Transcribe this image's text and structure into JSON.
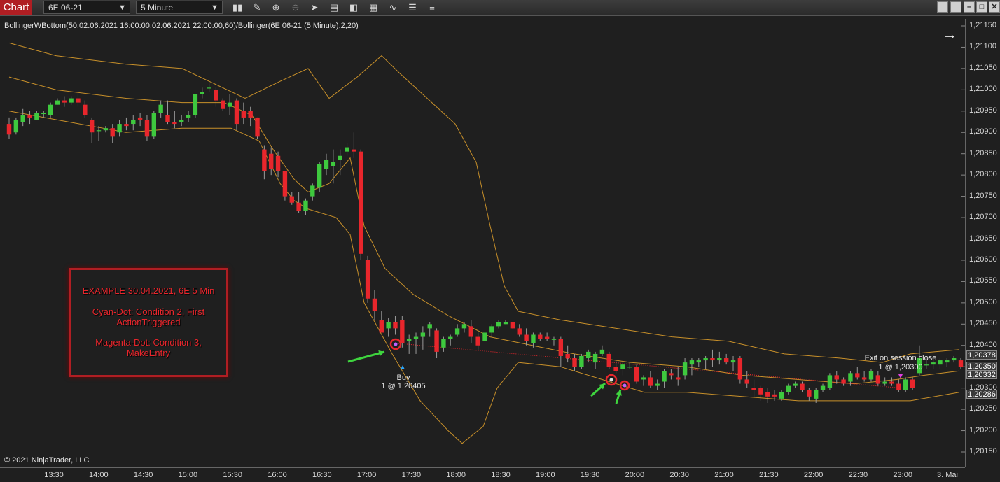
{
  "toolbar": {
    "tab_label": "Chart",
    "instrument": "6E 06-21",
    "interval": "5 Minute",
    "icons": [
      "bar-type-icon",
      "pencil-icon",
      "zoom-in-icon",
      "zoom-out-icon",
      "pointer-icon",
      "data-box-icon",
      "chart-trader-icon",
      "indicators-icon",
      "strategies-icon",
      "properties-icon",
      "list-icon"
    ],
    "window_icons": [
      "tile-icon",
      "maximize-all-icon",
      "minimize-icon",
      "restore-icon",
      "close-icon"
    ]
  },
  "chart": {
    "title": "BollingerWBottom(50,02.06.2021 16:00:00,02.06.2021 22:00:00,60)/Bollinger(6E 06-21 (5 Minute),2,20)",
    "copyright": "© 2021 NinjaTrader, LLC",
    "price_ticks": [
      "1,21150",
      "1,21100",
      "1,21050",
      "1,21000",
      "1,20950",
      "1,20900",
      "1,20850",
      "1,20800",
      "1,20750",
      "1,20700",
      "1,20650",
      "1,20600",
      "1,20550",
      "1,20500",
      "1,20450",
      "1,20400",
      "1,20350",
      "1,20300",
      "1,20250",
      "1,20200",
      "1,20150"
    ],
    "price_badges": [
      "1,20378",
      "1,20350",
      "1,20332",
      "1,20286"
    ],
    "time_ticks": [
      "13:30",
      "14:00",
      "14:30",
      "15:00",
      "15:30",
      "16:00",
      "16:30",
      "17:00",
      "17:30",
      "18:00",
      "18:30",
      "19:00",
      "19:30",
      "20:00",
      "20:30",
      "21:00",
      "21:30",
      "22:00",
      "22:30",
      "23:00",
      "3. Mai"
    ],
    "buy_label": "Buy",
    "buy_fill": "1 @ 1,20405",
    "exit_label": "Exit on session close",
    "exit_fill": "1 @ 1,20300",
    "colors": {
      "up": "#3ec93e",
      "down": "#e8262c",
      "band": "#c8902a",
      "marker": "#e8262c",
      "arrow": "#3ed43e"
    }
  },
  "note": {
    "line1": "EXAMPLE 30.04.2021, 6E 5 Min",
    "line2": "Cyan-Dot: Condition 2, First",
    "line3": "ActionTriggered",
    "line4": "Magenta-Dot: Condition 3,",
    "line5": "MakeEntry"
  },
  "chart_data": {
    "type": "candlestick",
    "y_range": [
      1.2012,
      1.2118
    ],
    "candles": [
      [
        1.2092,
        1.20935,
        1.20885,
        1.20895
      ],
      [
        1.209,
        1.20935,
        1.20895,
        1.2093
      ],
      [
        1.20925,
        1.20955,
        1.20915,
        1.2094
      ],
      [
        1.2094,
        1.2095,
        1.2092,
        1.20935
      ],
      [
        1.2093,
        1.2095,
        1.2093,
        1.20945
      ],
      [
        1.20945,
        1.2095,
        1.20935,
        1.20945
      ],
      [
        1.2094,
        1.2097,
        1.20935,
        1.20965
      ],
      [
        1.20965,
        1.2098,
        1.20965,
        1.20975
      ],
      [
        1.20975,
        1.20985,
        1.2096,
        1.2097
      ],
      [
        1.2097,
        1.20985,
        1.20965,
        1.2098
      ],
      [
        1.2098,
        1.20995,
        1.2096,
        1.2097
      ],
      [
        1.20965,
        1.20975,
        1.20935,
        1.2094
      ],
      [
        1.2093,
        1.20935,
        1.20875,
        1.209
      ],
      [
        1.20905,
        1.20915,
        1.2088,
        1.20905
      ],
      [
        1.20905,
        1.20915,
        1.209,
        1.2091
      ],
      [
        1.2091,
        1.2092,
        1.20875,
        1.2089
      ],
      [
        1.209,
        1.2093,
        1.2089,
        1.2092
      ],
      [
        1.2092,
        1.20935,
        1.20905,
        1.20915
      ],
      [
        1.2092,
        1.2094,
        1.20905,
        1.2093
      ],
      [
        1.20935,
        1.20945,
        1.20915,
        1.2093
      ],
      [
        1.2093,
        1.2094,
        1.2088,
        1.2089
      ],
      [
        1.2089,
        1.2095,
        1.20885,
        1.20945
      ],
      [
        1.20945,
        1.20975,
        1.20935,
        1.20965
      ],
      [
        1.2094,
        1.20975,
        1.2092,
        1.20925
      ],
      [
        1.20925,
        1.2095,
        1.2091,
        1.2092
      ],
      [
        1.20925,
        1.2094,
        1.20915,
        1.2093
      ],
      [
        1.20935,
        1.2095,
        1.20925,
        1.2094
      ],
      [
        1.2094,
        1.2099,
        1.20935,
        1.2099
      ],
      [
        1.2099,
        1.21005,
        1.2098,
        1.20995
      ],
      [
        1.21005,
        1.21015,
        1.20995,
        1.21005
      ],
      [
        1.21,
        1.21005,
        1.2096,
        1.20975
      ],
      [
        1.20975,
        1.2098,
        1.2095,
        1.20955
      ],
      [
        1.2096,
        1.2099,
        1.2094,
        1.2097
      ],
      [
        1.20975,
        1.2098,
        1.20905,
        1.2092
      ],
      [
        1.2095,
        1.2097,
        1.2092,
        1.20935
      ],
      [
        1.2095,
        1.2096,
        1.20915,
        1.20935
      ],
      [
        1.20935,
        1.20935,
        1.20885,
        1.2089
      ],
      [
        1.2086,
        1.2087,
        1.2079,
        1.2081
      ],
      [
        1.2085,
        1.20865,
        1.208,
        1.20815
      ],
      [
        1.20845,
        1.20855,
        1.20795,
        1.2081
      ],
      [
        1.2081,
        1.2081,
        1.2074,
        1.2075
      ],
      [
        1.2075,
        1.2076,
        1.2073,
        1.20735
      ],
      [
        1.20735,
        1.2076,
        1.2071,
        1.20715
      ],
      [
        1.20715,
        1.20745,
        1.20705,
        1.2074
      ],
      [
        1.2075,
        1.2078,
        1.2074,
        1.20775
      ],
      [
        1.2077,
        1.2083,
        1.2076,
        1.20825
      ],
      [
        1.20815,
        1.2085,
        1.208,
        1.20835
      ],
      [
        1.2082,
        1.2086,
        1.2078,
        1.2083
      ],
      [
        1.20835,
        1.2086,
        1.208,
        1.20845
      ],
      [
        1.20855,
        1.20875,
        1.20845,
        1.20865
      ],
      [
        1.2086,
        1.209,
        1.2084,
        1.20855
      ],
      [
        1.20855,
        1.2086,
        1.206,
        1.20615
      ],
      [
        1.206,
        1.2061,
        1.205,
        1.2051
      ],
      [
        1.2051,
        1.2053,
        1.2046,
        1.2048
      ],
      [
        1.2046,
        1.2048,
        1.2043,
        1.2043
      ],
      [
        1.2044,
        1.20465,
        1.2042,
        1.20455
      ],
      [
        1.20455,
        1.2047,
        1.20425,
        1.2044
      ],
      [
        1.2046,
        1.2047,
        1.20395,
        1.20405
      ],
      [
        1.2041,
        1.20425,
        1.2038,
        1.20415
      ],
      [
        1.20415,
        1.2043,
        1.2038,
        1.2042
      ],
      [
        1.2042,
        1.20445,
        1.2039,
        1.2043
      ],
      [
        1.2044,
        1.20455,
        1.2042,
        1.2045
      ],
      [
        1.20435,
        1.2044,
        1.2037,
        1.20385
      ],
      [
        1.20395,
        1.2042,
        1.20385,
        1.20415
      ],
      [
        1.20415,
        1.20425,
        1.204,
        1.2042
      ],
      [
        1.20425,
        1.2045,
        1.2042,
        1.2044
      ],
      [
        1.2044,
        1.20455,
        1.2043,
        1.2045
      ],
      [
        1.20445,
        1.2046,
        1.20405,
        1.2042
      ],
      [
        1.2042,
        1.2043,
        1.2039,
        1.204
      ],
      [
        1.2041,
        1.2044,
        1.20395,
        1.2043
      ],
      [
        1.2043,
        1.2045,
        1.2042,
        1.20445
      ],
      [
        1.20445,
        1.2046,
        1.2044,
        1.20455
      ],
      [
        1.2045,
        1.2046,
        1.2045,
        1.20455
      ],
      [
        1.20455,
        1.20455,
        1.2044,
        1.2044
      ],
      [
        1.2044,
        1.2045,
        1.2042,
        1.20425
      ],
      [
        1.20425,
        1.2044,
        1.204,
        1.2041
      ],
      [
        1.20405,
        1.2043,
        1.20395,
        1.20425
      ],
      [
        1.20425,
        1.2043,
        1.2041,
        1.20415
      ],
      [
        1.2042,
        1.2043,
        1.2041,
        1.20415
      ],
      [
        1.20415,
        1.2042,
        1.204,
        1.20415
      ],
      [
        1.20415,
        1.2042,
        1.2035,
        1.20375
      ],
      [
        1.2038,
        1.204,
        1.2036,
        1.2037
      ],
      [
        1.2037,
        1.2038,
        1.2034,
        1.2035
      ],
      [
        1.2035,
        1.2038,
        1.20345,
        1.20375
      ],
      [
        1.2037,
        1.2039,
        1.2036,
        1.20385
      ],
      [
        1.2036,
        1.20385,
        1.20345,
        1.2038
      ],
      [
        1.2038,
        1.204,
        1.20375,
        1.2039
      ],
      [
        1.2038,
        1.20385,
        1.20345,
        1.2035
      ],
      [
        1.2035,
        1.20365,
        1.20335,
        1.2034
      ],
      [
        1.20345,
        1.20365,
        1.2033,
        1.20355
      ],
      [
        1.2035,
        1.2036,
        1.20345,
        1.2035
      ],
      [
        1.2035,
        1.20355,
        1.2031,
        1.20315
      ],
      [
        1.2032,
        1.2033,
        1.20305,
        1.20325
      ],
      [
        1.20325,
        1.2034,
        1.203,
        1.20305
      ],
      [
        1.20305,
        1.2032,
        1.20295,
        1.2031
      ],
      [
        1.20315,
        1.20345,
        1.203,
        1.2034
      ],
      [
        1.20335,
        1.20345,
        1.2032,
        1.2033
      ],
      [
        1.20325,
        1.2035,
        1.20305,
        1.2032
      ],
      [
        1.2033,
        1.2037,
        1.2032,
        1.2036
      ],
      [
        1.20355,
        1.2037,
        1.2033,
        1.20365
      ],
      [
        1.2036,
        1.2037,
        1.2035,
        1.20365
      ],
      [
        1.20365,
        1.20375,
        1.20345,
        1.2037
      ],
      [
        1.2037,
        1.2039,
        1.2035,
        1.20365
      ],
      [
        1.20365,
        1.20385,
        1.20355,
        1.2037
      ],
      [
        1.2037,
        1.2038,
        1.20355,
        1.2036
      ],
      [
        1.2036,
        1.20375,
        1.2034,
        1.20365
      ],
      [
        1.2037,
        1.20375,
        1.2031,
        1.2032
      ],
      [
        1.2032,
        1.2034,
        1.203,
        1.2031
      ],
      [
        1.203,
        1.2032,
        1.2028,
        1.20295
      ],
      [
        1.203,
        1.20305,
        1.2027,
        1.20285
      ],
      [
        1.2029,
        1.203,
        1.20265,
        1.2028
      ],
      [
        1.20285,
        1.20295,
        1.2027,
        1.2028
      ],
      [
        1.20275,
        1.20295,
        1.2027,
        1.2029
      ],
      [
        1.2029,
        1.2031,
        1.20285,
        1.20305
      ],
      [
        1.20305,
        1.20315,
        1.203,
        1.2031
      ],
      [
        1.2031,
        1.20315,
        1.2029,
        1.20295
      ],
      [
        1.20295,
        1.203,
        1.2027,
        1.2028
      ],
      [
        1.20275,
        1.203,
        1.20265,
        1.20295
      ],
      [
        1.20295,
        1.2031,
        1.2029,
        1.20305
      ],
      [
        1.203,
        1.20335,
        1.20295,
        1.2033
      ],
      [
        1.2033,
        1.2034,
        1.2031,
        1.2032
      ],
      [
        1.2032,
        1.20325,
        1.20305,
        1.2031
      ],
      [
        1.20315,
        1.2034,
        1.20305,
        1.20335
      ],
      [
        1.20335,
        1.2035,
        1.2032,
        1.20325
      ],
      [
        1.20325,
        1.2034,
        1.20315,
        1.2032
      ],
      [
        1.2032,
        1.20345,
        1.20315,
        1.2034
      ],
      [
        1.2033,
        1.2034,
        1.20305,
        1.2031
      ],
      [
        1.2031,
        1.20325,
        1.20305,
        1.20315
      ],
      [
        1.20315,
        1.20325,
        1.20305,
        1.2031
      ],
      [
        1.2031,
        1.2032,
        1.2029,
        1.20295
      ],
      [
        1.20295,
        1.20325,
        1.2029,
        1.2032
      ],
      [
        1.2032,
        1.20325,
        1.20295,
        1.203
      ],
      [
        1.20335,
        1.204,
        1.2033,
        1.2037
      ],
      [
        1.20355,
        1.20375,
        1.20345,
        1.20355
      ],
      [
        1.20355,
        1.20365,
        1.20345,
        1.2036
      ],
      [
        1.20355,
        1.2037,
        1.20345,
        1.20365
      ],
      [
        1.2036,
        1.2037,
        1.2035,
        1.20365
      ],
      [
        1.20365,
        1.20375,
        1.2036,
        1.2037
      ],
      [
        1.20365,
        1.2037,
        1.20345,
        1.2035
      ]
    ],
    "bands": {
      "upper": [
        [
          13,
          1.2111
        ],
        [
          80,
          1.2108
        ],
        [
          180,
          1.2106
        ],
        [
          260,
          1.2105
        ],
        [
          350,
          1.2098
        ],
        [
          400,
          1.2102
        ],
        [
          440,
          1.2105
        ],
        [
          470,
          1.2098
        ],
        [
          510,
          1.2103
        ],
        [
          545,
          1.2108
        ],
        [
          570,
          1.2104
        ],
        [
          610,
          1.2098
        ],
        [
          650,
          1.2092
        ],
        [
          680,
          1.2083
        ],
        [
          700,
          1.2068
        ],
        [
          720,
          1.2054
        ],
        [
          740,
          1.2048
        ],
        [
          800,
          1.2046
        ],
        [
          880,
          1.2044
        ],
        [
          960,
          1.2042
        ],
        [
          1040,
          1.2041
        ],
        [
          1120,
          1.2038
        ],
        [
          1200,
          1.2037
        ],
        [
          1260,
          1.2036
        ],
        [
          1300,
          1.2038
        ],
        [
          1370,
          1.2039
        ]
      ],
      "middle": [
        [
          13,
          1.2103
        ],
        [
          80,
          1.21
        ],
        [
          180,
          1.2098
        ],
        [
          260,
          1.2097
        ],
        [
          320,
          1.2097
        ],
        [
          360,
          1.2094
        ],
        [
          390,
          1.2086
        ],
        [
          420,
          1.2079
        ],
        [
          440,
          1.2076
        ],
        [
          470,
          1.2078
        ],
        [
          500,
          1.2084
        ],
        [
          520,
          1.2068
        ],
        [
          550,
          1.2058
        ],
        [
          590,
          1.2052
        ],
        [
          640,
          1.2047
        ],
        [
          700,
          1.2042
        ],
        [
          760,
          1.204
        ],
        [
          820,
          1.2038
        ],
        [
          900,
          1.2036
        ],
        [
          980,
          1.2035
        ],
        [
          1060,
          1.2033
        ],
        [
          1140,
          1.2032
        ],
        [
          1220,
          1.2031
        ],
        [
          1280,
          1.2032
        ],
        [
          1320,
          1.2033
        ],
        [
          1370,
          1.2034
        ]
      ],
      "lower": [
        [
          13,
          1.2095
        ],
        [
          80,
          1.2093
        ],
        [
          180,
          1.209
        ],
        [
          260,
          1.2091
        ],
        [
          330,
          1.2091
        ],
        [
          370,
          1.2088
        ],
        [
          400,
          1.2078
        ],
        [
          420,
          1.2074
        ],
        [
          440,
          1.2072
        ],
        [
          480,
          1.207
        ],
        [
          500,
          1.2066
        ],
        [
          520,
          1.205
        ],
        [
          560,
          1.2038
        ],
        [
          600,
          1.2027
        ],
        [
          640,
          1.202
        ],
        [
          660,
          1.2017
        ],
        [
          690,
          1.2021
        ],
        [
          710,
          1.203
        ],
        [
          740,
          1.2036
        ],
        [
          800,
          1.2035
        ],
        [
          860,
          1.2032
        ],
        [
          920,
          1.2029
        ],
        [
          980,
          1.2029
        ],
        [
          1060,
          1.2028
        ],
        [
          1140,
          1.2027
        ],
        [
          1220,
          1.2027
        ],
        [
          1300,
          1.2027
        ],
        [
          1370,
          1.2029
        ]
      ]
    }
  }
}
